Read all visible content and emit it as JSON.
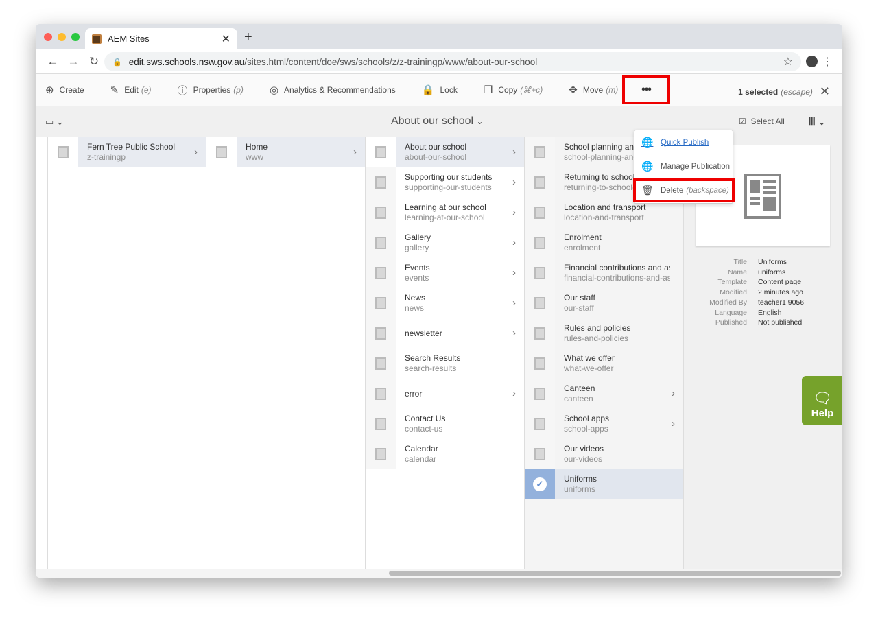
{
  "browser": {
    "tab_title": "AEM Sites",
    "url_host": "edit.sws.schools.nsw.gov.au",
    "url_path": "/sites.html/content/doe/sws/schools/z/z-trainingp/www/about-our-school"
  },
  "toolbar": {
    "items": [
      {
        "icon": "plus-circle-icon",
        "label": "Create",
        "shortcut": ""
      },
      {
        "icon": "pencil-icon",
        "label": "Edit",
        "shortcut": "(e)"
      },
      {
        "icon": "info-icon",
        "label": "Properties",
        "shortcut": "(p)"
      },
      {
        "icon": "analytics-icon",
        "label": "Analytics & Recommendations",
        "shortcut": ""
      },
      {
        "icon": "lock-icon",
        "label": "Lock",
        "shortcut": ""
      },
      {
        "icon": "copy-icon",
        "label": "Copy",
        "shortcut": "(⌘+c)"
      },
      {
        "icon": "move-icon",
        "label": "Move",
        "shortcut": "(m)"
      }
    ],
    "more_label": "•••",
    "selected_label": "1 selected",
    "selected_hint": "(escape)"
  },
  "subheader": {
    "title": "About our school",
    "select_all": "Select All"
  },
  "more_menu": [
    {
      "icon": "globe-icon",
      "label": "Quick Publish",
      "hint": ""
    },
    {
      "icon": "globe-clock-icon",
      "label": "Manage Publication",
      "hint": ""
    },
    {
      "icon": "trash-icon",
      "label": "Delete",
      "hint": "(backspace)"
    }
  ],
  "columns": [
    [
      {
        "title": "Fern Tree Public School",
        "name": "z-trainingp",
        "children": true,
        "active": true
      }
    ],
    [
      {
        "title": "Home",
        "name": "www",
        "children": true,
        "active": true
      }
    ],
    [
      {
        "title": "About our school",
        "name": "about-our-school",
        "children": true,
        "active": true
      },
      {
        "title": "Supporting our students",
        "name": "supporting-our-students",
        "children": true
      },
      {
        "title": "Learning at our school",
        "name": "learning-at-our-school",
        "children": true
      },
      {
        "title": "Gallery",
        "name": "gallery",
        "children": true
      },
      {
        "title": "Events",
        "name": "events",
        "children": true
      },
      {
        "title": "News",
        "name": "news",
        "children": true
      },
      {
        "title": "newsletter",
        "name": "",
        "children": true
      },
      {
        "title": "Search Results",
        "name": "search-results",
        "children": false
      },
      {
        "title": "error",
        "name": "",
        "children": true
      },
      {
        "title": "Contact Us",
        "name": "contact-us",
        "children": false
      },
      {
        "title": "Calendar",
        "name": "calendar",
        "children": false
      }
    ],
    [
      {
        "title": "School planning and reporting",
        "name": "school-planning-and-reporting",
        "children": false
      },
      {
        "title": "Returning to school safely",
        "name": "returning-to-school-safely",
        "children": false
      },
      {
        "title": "Location and transport",
        "name": "location-and-transport",
        "children": false
      },
      {
        "title": "Enrolment",
        "name": "enrolment",
        "children": false
      },
      {
        "title": "Financial contributions and assistance",
        "name": "financial-contributions-and-assistance",
        "children": false
      },
      {
        "title": "Our staff",
        "name": "our-staff",
        "children": false
      },
      {
        "title": "Rules and policies",
        "name": "rules-and-policies",
        "children": false
      },
      {
        "title": "What we offer",
        "name": "what-we-offer",
        "children": false
      },
      {
        "title": "Canteen",
        "name": "canteen",
        "children": true
      },
      {
        "title": "School apps",
        "name": "school-apps",
        "children": true
      },
      {
        "title": "Our videos",
        "name": "our-videos",
        "children": false
      },
      {
        "title": "Uniforms",
        "name": "uniforms",
        "children": false,
        "selected": true
      }
    ]
  ],
  "preview": {
    "meta": [
      {
        "k": "Title",
        "v": "Uniforms"
      },
      {
        "k": "Name",
        "v": "uniforms"
      },
      {
        "k": "Template",
        "v": "Content page"
      },
      {
        "k": "Modified",
        "v": "2 minutes ago"
      },
      {
        "k": "Modified By",
        "v": "teacher1 9056"
      },
      {
        "k": "Language",
        "v": "English"
      },
      {
        "k": "Published",
        "v": "Not published"
      }
    ]
  },
  "help": {
    "label": "Help"
  },
  "colors": {
    "highlight": "#e00000",
    "help": "#76a22b",
    "link": "#2468c4"
  }
}
